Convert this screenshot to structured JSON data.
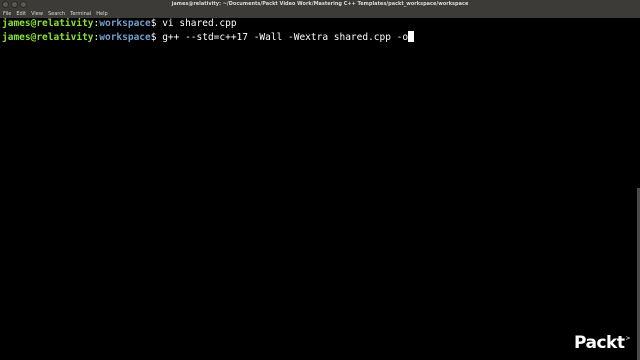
{
  "window": {
    "title": "james@relativity: ~/Documents/Packt Video Work/Mastering C++ Templates/packt_workspace/workspace"
  },
  "menu": [
    "File",
    "Edit",
    "View",
    "Search",
    "Terminal",
    "Help"
  ],
  "terminal": {
    "lines": [
      {
        "user_host": "james@relativity",
        "sep": ":",
        "path": "workspace",
        "symbol": "$ ",
        "command": "vi shared.cpp"
      },
      {
        "user_host": "james@relativity",
        "sep": ":",
        "path": "workspace",
        "symbol": "$ ",
        "command": "g++ --std=c++17 -Wall -Wextra shared.cpp -o"
      }
    ]
  },
  "logo": {
    "text": "Packt",
    "sup": ">"
  },
  "colors": {
    "prompt_user": "#8ae234",
    "prompt_path": "#729fcf",
    "background": "#000000",
    "titlebar": "#3c3b37"
  }
}
